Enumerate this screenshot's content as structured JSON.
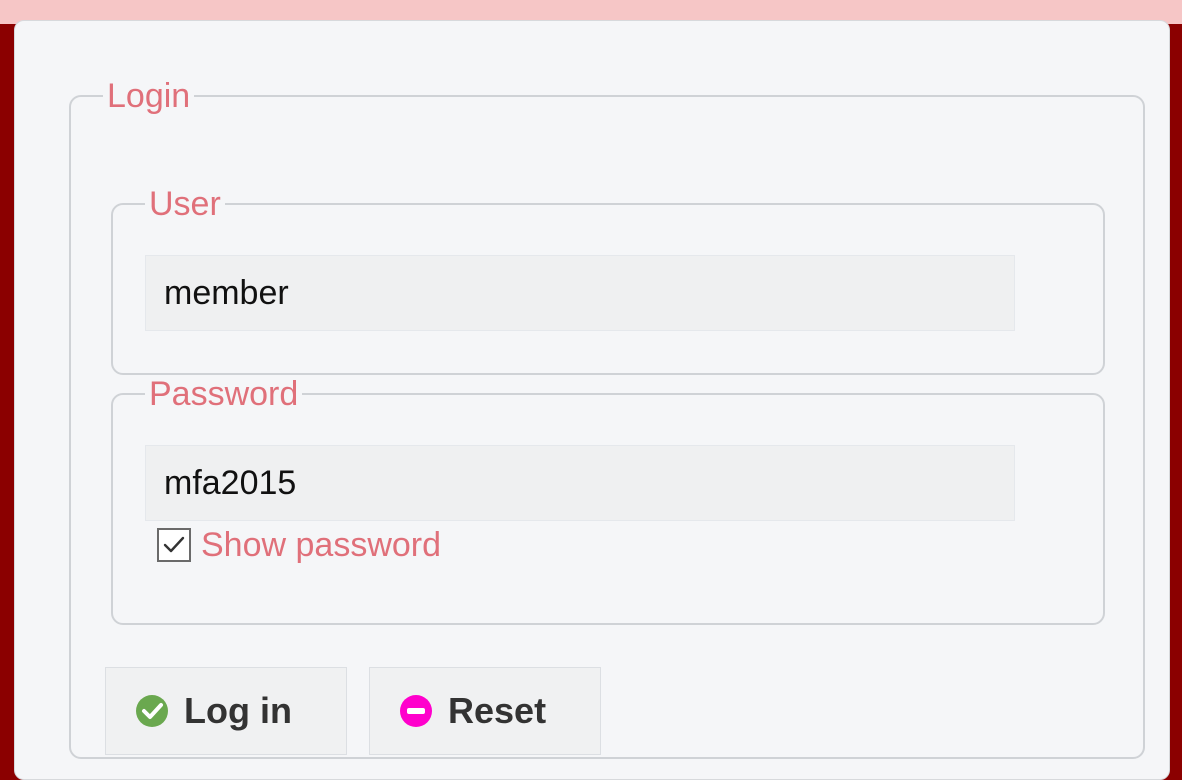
{
  "login_panel": {
    "legend": "Login",
    "user": {
      "legend": "User",
      "value": "member"
    },
    "password": {
      "legend": "Password",
      "value": "mfa2015",
      "show_password": {
        "label": "Show password",
        "checked": true
      }
    },
    "buttons": {
      "login_label": "Log in",
      "reset_label": "Reset"
    }
  },
  "icons": {
    "login_icon": "check-circle-icon",
    "reset_icon": "minus-circle-icon"
  },
  "colors": {
    "accent_text": "#e0707a",
    "frame": "#8b0000",
    "login_icon": "#6aa84f",
    "reset_icon": "#ff00cc"
  }
}
